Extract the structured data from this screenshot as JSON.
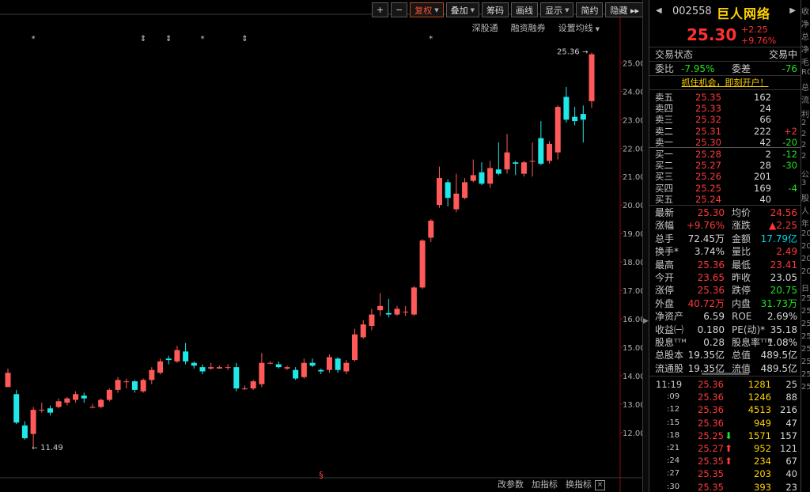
{
  "toolbar": {
    "plus": "+",
    "minus": "−",
    "items": [
      {
        "label": "复权",
        "caret": true,
        "active": true
      },
      {
        "label": "叠加",
        "caret": true,
        "active": false
      },
      {
        "label": "筹码",
        "caret": false,
        "active": false
      },
      {
        "label": "画线",
        "caret": false,
        "active": false
      },
      {
        "label": "显示",
        "caret": true,
        "active": false
      },
      {
        "label": "简约",
        "caret": false,
        "active": false
      },
      {
        "label": "隐藏 ▸▸",
        "caret": false,
        "active": false
      }
    ],
    "sub": [
      "深股通",
      "融资融券",
      "设置均线"
    ]
  },
  "bottom_bar": [
    "改参数",
    "加指标",
    "换指标"
  ],
  "close_glyph": "×",
  "chart_data": {
    "type": "candlestick",
    "yticks": [
      "25.00",
      "24.00",
      "23.00",
      "22.00",
      "21.00",
      "20.00",
      "19.00",
      "18.00",
      "17.00",
      "16.00",
      "15.00",
      "14.00",
      "13.00",
      "12.00"
    ],
    "ylim": [
      11.3,
      25.4
    ],
    "max_label": "25.36",
    "min_label": "11.49",
    "markers": [
      "*",
      "⇕",
      "⇕",
      "*",
      "⇕",
      "*"
    ],
    "bottom_marker": "§",
    "candles": [
      [
        13.6,
        14.1,
        13.6,
        14.25
      ],
      [
        13.35,
        12.35,
        12.3,
        13.5
      ],
      [
        12.25,
        11.8,
        11.75,
        12.4
      ],
      [
        11.95,
        12.8,
        11.49,
        12.9
      ],
      [
        12.8,
        12.8,
        12.7,
        13.05
      ],
      [
        12.85,
        12.7,
        12.6,
        12.95
      ],
      [
        12.9,
        13.1,
        12.85,
        13.2
      ],
      [
        13.05,
        13.2,
        12.95,
        13.25
      ],
      [
        13.15,
        13.35,
        13.05,
        13.45
      ],
      [
        13.3,
        13.2,
        13.05,
        13.4
      ],
      [
        12.9,
        12.9,
        12.85,
        13.0
      ],
      [
        12.9,
        13.15,
        12.85,
        13.2
      ],
      [
        13.15,
        13.5,
        13.1,
        13.55
      ],
      [
        13.5,
        13.85,
        13.4,
        13.95
      ],
      [
        13.8,
        13.8,
        13.55,
        13.9
      ],
      [
        13.8,
        13.5,
        13.4,
        13.85
      ],
      [
        13.45,
        13.85,
        13.4,
        13.9
      ],
      [
        13.85,
        14.2,
        13.7,
        14.3
      ],
      [
        14.1,
        14.5,
        14.05,
        14.6
      ],
      [
        14.6,
        14.55,
        14.4,
        14.7
      ],
      [
        14.5,
        14.9,
        14.45,
        15.05
      ],
      [
        14.85,
        14.5,
        14.4,
        15.15
      ],
      [
        14.45,
        14.35,
        14.25,
        14.5
      ],
      [
        14.3,
        14.15,
        14.05,
        14.4
      ],
      [
        14.25,
        14.3,
        14.2,
        14.45
      ],
      [
        14.25,
        14.3,
        14.25,
        14.35
      ],
      [
        14.3,
        14.3,
        14.2,
        14.4
      ],
      [
        14.3,
        13.55,
        13.45,
        14.45
      ],
      [
        13.55,
        13.55,
        13.5,
        13.65
      ],
      [
        13.55,
        13.8,
        13.5,
        13.85
      ],
      [
        13.7,
        14.45,
        13.6,
        14.8
      ],
      [
        14.45,
        14.45,
        14.4,
        14.5
      ],
      [
        14.4,
        14.3,
        14.25,
        14.5
      ],
      [
        14.25,
        14.3,
        14.2,
        14.35
      ],
      [
        14.2,
        13.9,
        13.85,
        14.3
      ],
      [
        13.95,
        14.45,
        13.9,
        14.6
      ],
      [
        14.45,
        14.35,
        14.3,
        14.6
      ],
      [
        14.2,
        14.15,
        14.05,
        14.25
      ],
      [
        14.2,
        14.65,
        14.1,
        14.75
      ],
      [
        14.6,
        14.2,
        14.1,
        14.65
      ],
      [
        14.15,
        14.45,
        14.05,
        14.55
      ],
      [
        14.55,
        15.45,
        14.5,
        15.65
      ],
      [
        15.35,
        15.8,
        15.3,
        15.95
      ],
      [
        15.75,
        16.15,
        15.6,
        16.35
      ],
      [
        16.3,
        16.45,
        16.1,
        16.9
      ],
      [
        16.2,
        16.15,
        16.05,
        16.7
      ],
      [
        16.15,
        16.35,
        16.1,
        16.45
      ],
      [
        16.25,
        16.25,
        16.1,
        16.45
      ],
      [
        16.15,
        17.1,
        16.1,
        17.15
      ],
      [
        17.1,
        18.75,
        17.05,
        18.8
      ],
      [
        18.85,
        19.45,
        18.7,
        19.5
      ],
      [
        20.0,
        20.95,
        19.9,
        21.35
      ],
      [
        20.8,
        20.25,
        19.95,
        20.9
      ],
      [
        19.85,
        20.4,
        19.75,
        21.1
      ],
      [
        20.25,
        20.8,
        20.2,
        20.95
      ],
      [
        20.85,
        21.05,
        20.8,
        21.6
      ],
      [
        21.15,
        20.75,
        20.7,
        21.5
      ],
      [
        20.75,
        21.3,
        20.6,
        21.55
      ],
      [
        21.25,
        21.1,
        21.05,
        22.2
      ],
      [
        21.25,
        21.85,
        21.1,
        22.5
      ],
      [
        21.5,
        21.45,
        21.05,
        21.55
      ],
      [
        21.1,
        21.5,
        21.0,
        21.55
      ],
      [
        21.55,
        21.55,
        21.0,
        22.2
      ],
      [
        22.35,
        21.45,
        21.4,
        22.95
      ],
      [
        21.55,
        22.15,
        21.45,
        22.25
      ],
      [
        21.85,
        23.45,
        21.6,
        23.5
      ],
      [
        23.8,
        23.0,
        22.9,
        24.15
      ],
      [
        23.1,
        22.95,
        22.8,
        23.45
      ],
      [
        23.2,
        23.0,
        22.2,
        23.5
      ],
      [
        23.65,
        25.3,
        23.41,
        25.36
      ]
    ]
  },
  "stock": {
    "nav_prev": "◀",
    "nav_next": "▶",
    "code": "002558",
    "name": "巨人网络",
    "price": "25.30",
    "change": "+2.25",
    "pct": "+9.76%"
  },
  "trade_state": {
    "label": "交易状态",
    "value": "交易中"
  },
  "weibi": {
    "l1": "委比",
    "v1": "-7.95%",
    "l2": "委差",
    "v2": "-76"
  },
  "promo": "抓住机会，即刻开户！",
  "orderbook": {
    "asks": [
      {
        "label": "卖五",
        "price": "25.35",
        "vol": "162",
        "delta": ""
      },
      {
        "label": "卖四",
        "price": "25.33",
        "vol": "24",
        "delta": ""
      },
      {
        "label": "卖三",
        "price": "25.32",
        "vol": "66",
        "delta": ""
      },
      {
        "label": "卖二",
        "price": "25.31",
        "vol": "222",
        "delta": "+2"
      },
      {
        "label": "卖一",
        "price": "25.30",
        "vol": "42",
        "delta": "-20"
      }
    ],
    "bids": [
      {
        "label": "买一",
        "price": "25.28",
        "vol": "2",
        "delta": "-12"
      },
      {
        "label": "买二",
        "price": "25.27",
        "vol": "28",
        "delta": "-30"
      },
      {
        "label": "买三",
        "price": "25.26",
        "vol": "201",
        "delta": ""
      },
      {
        "label": "买四",
        "price": "25.25",
        "vol": "169",
        "delta": "-4"
      },
      {
        "label": "买五",
        "price": "25.24",
        "vol": "40",
        "delta": ""
      }
    ]
  },
  "quote": [
    {
      "l1": "最新",
      "v1": "25.30",
      "c1": "r",
      "l2": "均价",
      "v2": "24.56",
      "c2": "r"
    },
    {
      "l1": "涨幅",
      "v1": "+9.76%",
      "c1": "r",
      "l2": "涨跌",
      "v2": "▲2.25",
      "c2": "r"
    },
    {
      "l1": "总手",
      "v1": "72.45万",
      "c1": "w",
      "l2": "金额",
      "v2": "17.79亿",
      "c2": "c"
    },
    {
      "l1": "换手*",
      "v1": "3.74%",
      "c1": "w",
      "l2": "量比",
      "v2": "2.49",
      "c2": "r"
    },
    {
      "l1": "最高",
      "v1": "25.36",
      "c1": "r",
      "l2": "最低",
      "v2": "23.41",
      "c2": "r"
    },
    {
      "l1": "今开",
      "v1": "23.65",
      "c1": "r",
      "l2": "昨收",
      "v2": "23.05",
      "c2": "w"
    },
    {
      "l1": "涨停",
      "v1": "25.36",
      "c1": "r",
      "l2": "跌停",
      "v2": "20.75",
      "c2": "g"
    },
    {
      "l1": "外盘",
      "v1": "40.72万",
      "c1": "r",
      "l2": "内盘",
      "v2": "31.73万",
      "c2": "g"
    },
    {
      "l1": "净资产",
      "v1": "6.59",
      "c1": "w",
      "l2": "ROE",
      "v2": "2.69%",
      "c2": "w"
    },
    {
      "l1": "收益㈠",
      "v1": "0.180",
      "c1": "w",
      "l2": "PE(动)*",
      "v2": "35.18",
      "c2": "w"
    },
    {
      "l1": "股息ᵀᵀᴹ",
      "v1": "0.28",
      "c1": "w",
      "l2": "股息率ᵀᵀᴹ",
      "v2": "1.08%",
      "c2": "w"
    },
    {
      "l1": "总股本",
      "v1": "19.35亿",
      "c1": "w",
      "l2": "总值",
      "v2": "489.5亿",
      "c2": "w"
    },
    {
      "l1": "流通股",
      "v1": "19.35亿",
      "c1": "w",
      "l2": "流值",
      "v2": "489.5亿",
      "c2": "w"
    }
  ],
  "ticks": [
    {
      "time": "11:19",
      "price": "25.36",
      "pc": "r",
      "arrow": "",
      "vol": "1281",
      "num": "25"
    },
    {
      "time": ":09",
      "price": "25.36",
      "pc": "r",
      "arrow": "",
      "vol": "1246",
      "num": "88"
    },
    {
      "time": ":12",
      "price": "25.36",
      "pc": "r",
      "arrow": "",
      "vol": "4513",
      "num": "216"
    },
    {
      "time": ":15",
      "price": "25.36",
      "pc": "r",
      "arrow": "",
      "vol": "949",
      "num": "47"
    },
    {
      "time": ":18",
      "price": "25.25",
      "pc": "r",
      "arrow": "⬇",
      "ac": "g",
      "vol": "1571",
      "num": "157"
    },
    {
      "time": ":21",
      "price": "25.27",
      "pc": "r",
      "arrow": "⬆",
      "ac": "r",
      "vol": "952",
      "num": "121"
    },
    {
      "time": ":24",
      "price": "25.35",
      "pc": "r",
      "arrow": "⬆",
      "ac": "r",
      "vol": "234",
      "num": "67"
    },
    {
      "time": ":27",
      "price": "25.35",
      "pc": "r",
      "arrow": "",
      "vol": "203",
      "num": "40"
    },
    {
      "time": ":30",
      "price": "25.35",
      "pc": "r",
      "arrow": "",
      "vol": "393",
      "num": "23"
    }
  ],
  "side_strip": [
    "收",
    "净",
    "总",
    "净",
    "毛",
    "ROE",
    "总",
    "流",
    "利",
    "2",
    "2",
    "2",
    "2",
    "公",
    "3",
    "股",
    "人",
    "年",
    "20",
    "20",
    "20",
    "20",
    "日",
    "25",
    "25",
    "25",
    "25",
    "25",
    "25",
    "25",
    "25"
  ],
  "colors": {
    "up": "#ff5a5a",
    "down": "#20e8e8",
    "text_up": "#ff3838",
    "text_down": "#20e020",
    "name": "#ffd200"
  }
}
